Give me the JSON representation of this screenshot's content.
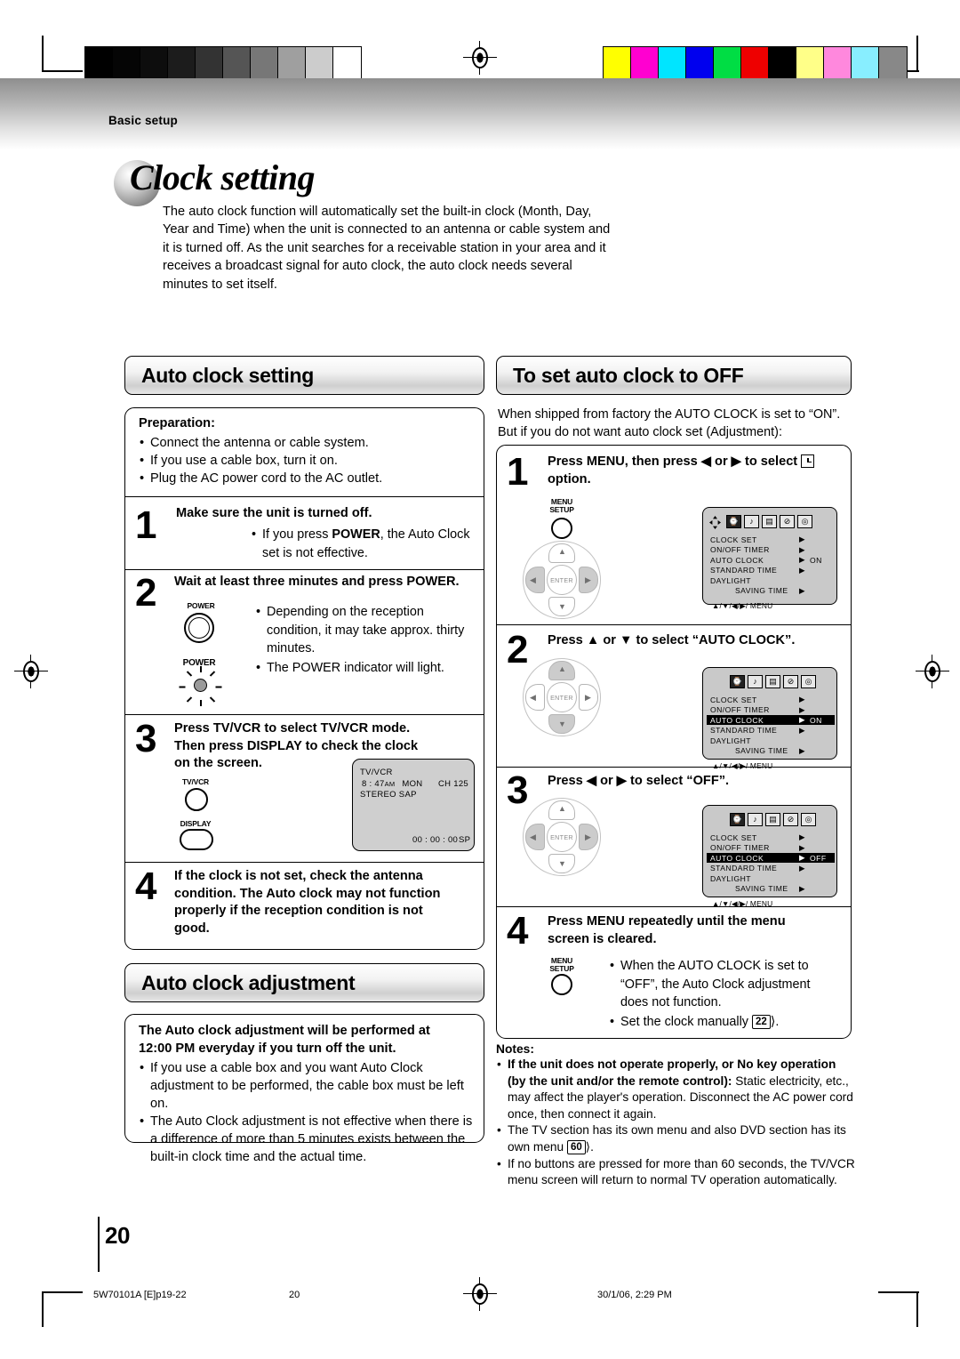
{
  "page": {
    "chapter": "Basic setup",
    "title": "Clock setting",
    "intro": "The auto clock function will automatically set the built-in clock (Month, Day, Year and Time) when the unit  is connected to an antenna or cable system and it is turned off. As the unit searches for a receivable station in your area and it receives a broadcast signal for auto clock, the auto clock needs several minutes to set itself.",
    "number": "20"
  },
  "colors": {
    "osd_background": "#c9c9c9",
    "tv_background": "#cfcfcf",
    "highlight": "#000000"
  },
  "top_bars": {
    "grayscale": [
      "#000000",
      "#050505",
      "#0d0d0d",
      "#1c1c1c",
      "#333333",
      "#555555",
      "#777777",
      "#9f9f9f",
      "#cccccc",
      "#ffffff"
    ],
    "color": [
      "#ffff00",
      "#ff00d0",
      "#00e5ff",
      "#0000ee",
      "#00dd44",
      "#ee0000",
      "#000000",
      "#ffff88",
      "#ff88dd",
      "#88eeff",
      "#888888"
    ]
  },
  "left_column": {
    "heading": "Auto clock setting",
    "preparation": {
      "title": "Preparation:",
      "items": [
        "Connect the antenna or cable system.",
        "If you use a cable box, turn it on.",
        "Plug the AC power cord to the AC outlet."
      ]
    },
    "steps": [
      {
        "number": "1",
        "text": "Make sure the unit is turned off.",
        "notes": [
          "If you press POWER, the Auto Clock set is not effective."
        ]
      },
      {
        "number": "2",
        "text": "Wait at least three minutes and press POWER.",
        "button_labels": [
          "POWER",
          "POWER"
        ],
        "notes": [
          "Depending on the reception condition, it may take approx. thirty minutes.",
          "The POWER indicator will light."
        ]
      },
      {
        "number": "3",
        "text": "Press TV/VCR to select TV/VCR mode. Then press DISPLAY to check the clock on the screen.",
        "button_labels": [
          "TV/VCR",
          "DISPLAY"
        ],
        "tv_screen": {
          "line1": "TV/VCR",
          "time": "8 : 47",
          "ampm": "AM",
          "day": "MON",
          "channel": "CH  125",
          "audio": "STEREO  SAP",
          "counter": "00 : 00 : 00",
          "speed": "SP"
        }
      },
      {
        "number": "4",
        "text": "If the clock is not set, check the antenna condition. The Auto clock may not function properly if the reception condition is not good."
      }
    ],
    "adjustment": {
      "heading": "Auto clock adjustment",
      "bold_lines": [
        "The Auto clock adjustment will be performed at",
        "12:00 PM everyday if you turn off the unit."
      ],
      "items": [
        "If you use a cable box and you want Auto Clock adjustment to be performed, the cable box must be left on.",
        "The Auto Clock adjustment is not effective when there is a difference of more than 5 minutes exists between the built-in clock time and the actual time."
      ]
    }
  },
  "right_column": {
    "heading": "To set auto clock to OFF",
    "intro": [
      "When shipped from factory the AUTO CLOCK is set to “ON”.",
      "But if you do not want auto clock set (Adjustment):"
    ],
    "steps": [
      {
        "number": "1",
        "text_a": "Press MENU, then press ◀ or ▶ to select ",
        "text_b": " option.",
        "button_labels": [
          "MENU",
          "SETUP"
        ],
        "dpad_active": "leftright"
      },
      {
        "number": "2",
        "text": "Press ▲ or ▼ to select “AUTO CLOCK”.",
        "dpad_active": "updown"
      },
      {
        "number": "3",
        "text": "Press ◀ or ▶ to select “OFF”.",
        "dpad_active": "leftright"
      },
      {
        "number": "4",
        "text": "Press MENU repeatedly until the menu screen is cleared.",
        "button_labels": [
          "MENU",
          "SETUP"
        ],
        "notes": [
          "When the AUTO CLOCK is set to “OFF”, the Auto Clock adjustment does not function.",
          "Set the clock manually "
        ],
        "page_ref": "22"
      }
    ],
    "osd_menus": [
      {
        "id": "osd-1",
        "has_cursor": true,
        "rows": [
          {
            "label": "CLOCK  SET",
            "arrow": "▶",
            "value": "",
            "highlight": false
          },
          {
            "label": "ON/OFF  TIMER",
            "arrow": "▶",
            "value": "",
            "highlight": false
          },
          {
            "label": "AUTO  CLOCK",
            "arrow": "▶",
            "value": "ON",
            "highlight": false
          },
          {
            "label": "STANDARD  TIME",
            "arrow": "▶",
            "value": "",
            "highlight": false
          },
          {
            "label": "DAYLIGHT",
            "arrow": "",
            "value": "",
            "highlight": false
          },
          {
            "label": "SAVING  TIME",
            "arrow": "▶",
            "value": "",
            "highlight": false,
            "indent": true
          }
        ],
        "footer": "▲/▼/◀/▶/ MENU"
      },
      {
        "id": "osd-2",
        "has_cursor": false,
        "rows": [
          {
            "label": "CLOCK  SET",
            "arrow": "▶",
            "value": "",
            "highlight": false
          },
          {
            "label": "ON/OFF  TIMER",
            "arrow": "▶",
            "value": "",
            "highlight": false
          },
          {
            "label": "AUTO  CLOCK",
            "arrow": "▶",
            "value": "ON",
            "highlight": true
          },
          {
            "label": "STANDARD  TIME",
            "arrow": "▶",
            "value": "",
            "highlight": false
          },
          {
            "label": "DAYLIGHT",
            "arrow": "",
            "value": "",
            "highlight": false
          },
          {
            "label": "SAVING  TIME",
            "arrow": "▶",
            "value": "",
            "highlight": false,
            "indent": true
          }
        ],
        "footer": "▲/▼/◀/▶/ MENU"
      },
      {
        "id": "osd-3",
        "has_cursor": false,
        "rows": [
          {
            "label": "CLOCK  SET",
            "arrow": "▶",
            "value": "",
            "highlight": false
          },
          {
            "label": "ON/OFF  TIMER",
            "arrow": "▶",
            "value": "",
            "highlight": false
          },
          {
            "label": "AUTO  CLOCK",
            "arrow": "▶",
            "value": "OFF",
            "highlight": true
          },
          {
            "label": "STANDARD  TIME",
            "arrow": "▶",
            "value": "",
            "highlight": false
          },
          {
            "label": "DAYLIGHT",
            "arrow": "",
            "value": "",
            "highlight": false
          },
          {
            "label": "SAVING  TIME",
            "arrow": "▶",
            "value": "",
            "highlight": false,
            "indent": true
          }
        ],
        "footer": "▲/▼/◀/▶/ MENU"
      }
    ],
    "osd_icons": [
      "clock-icon",
      "audio-icon",
      "list-icon",
      "circle-slash-icon",
      "tape-icon"
    ],
    "notes": {
      "title": "Notes:",
      "items": [
        {
          "bold": "If the unit does not operate properly, or No key operation (by the unit and/or the remote control):",
          "rest": " Static electricity, etc., may affect the player's operation. Disconnect the AC power cord once, then connect it again."
        },
        {
          "bold": "",
          "rest": "The TV section has its own menu and also DVD section has its own menu ",
          "page_ref": "60"
        },
        {
          "bold": "",
          "rest": "If no buttons are pressed for more than 60 seconds, the TV/VCR menu screen will return to normal TV operation automatically."
        }
      ]
    }
  },
  "footer": {
    "left": "5W70101A [E]p19-22",
    "center": "20",
    "right": "30/1/06, 2:29 PM"
  }
}
